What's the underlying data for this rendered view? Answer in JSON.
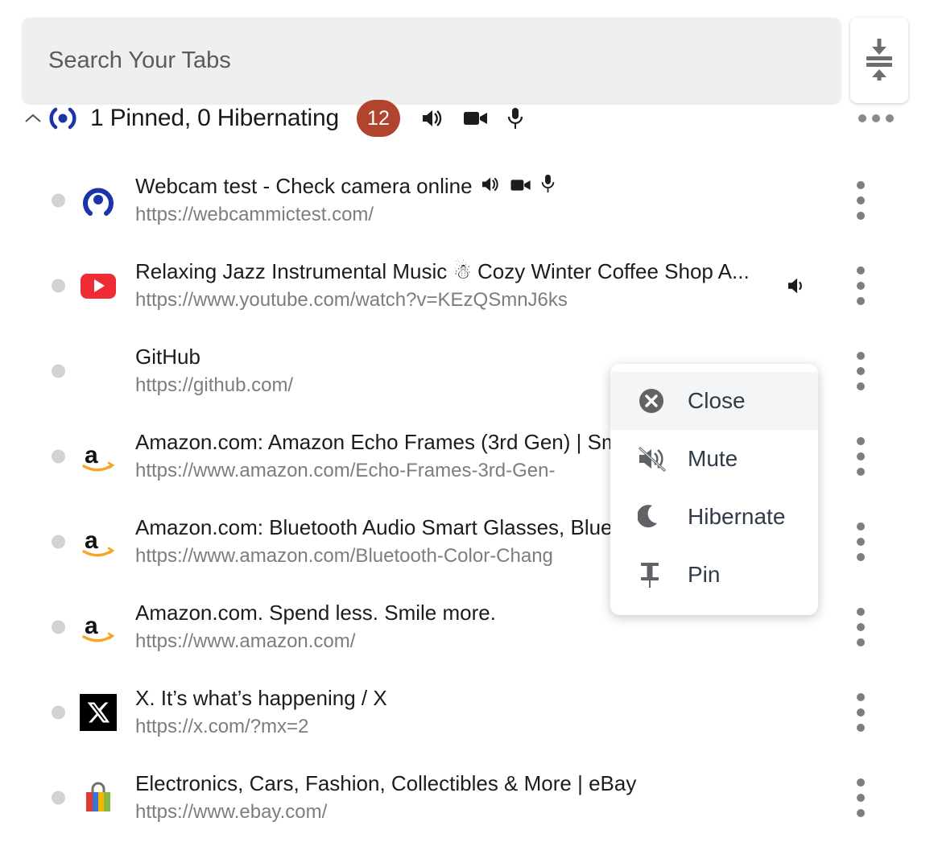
{
  "search": {
    "placeholder": "Search Your Tabs",
    "value": ""
  },
  "toolbar": {
    "merge_icon": "collapse-merge-icon",
    "overflow_icon": "more-horizontal-icon"
  },
  "group_header": {
    "collapse_icon": "chevron-up-icon",
    "favicon": "broadcast-icon",
    "title": "1 Pinned, 0 Hibernating",
    "count": "12",
    "badge_color": "#b1442f",
    "icons": [
      "speaker-icon",
      "video-camera-icon",
      "microphone-icon"
    ]
  },
  "tabs": [
    {
      "title": "Webcam test - Check camera online",
      "url": "https://webcammictest.com/",
      "favicon": "webcammictest-icon",
      "title_icons": [
        "speaker-icon",
        "video-camera-icon",
        "microphone-icon"
      ],
      "audio_icon": "",
      "menu_icon": "more-vertical-icon"
    },
    {
      "title": "Relaxing Jazz Instrumental Music ☃ Cozy Winter Coffee Shop A...",
      "url": "https://www.youtube.com/watch?v=KEzQSmnJ6ks",
      "favicon": "youtube-icon",
      "title_icons": [],
      "audio_icon": "speaker-icon",
      "menu_icon": "more-vertical-icon"
    },
    {
      "title": "GitHub",
      "url": "https://github.com/",
      "favicon": "blank-icon",
      "title_icons": [],
      "audio_icon": "",
      "menu_icon": "more-vertical-icon"
    },
    {
      "title": "Amazon.com: Amazon Echo Frames (3rd Gen) | Sm",
      "url": "https://www.amazon.com/Echo-Frames-3rd-Gen-",
      "favicon": "amazon-icon",
      "title_icons": [],
      "audio_icon": "",
      "menu_icon": "more-vertical-icon"
    },
    {
      "title": "Amazon.com: Bluetooth Audio Smart Glasses, Blue",
      "url": "https://www.amazon.com/Bluetooth-Color-Chang",
      "favicon": "amazon-icon",
      "title_icons": [],
      "audio_icon": "",
      "menu_icon": "more-vertical-icon"
    },
    {
      "title": "Amazon.com. Spend less. Smile more.",
      "url": "https://www.amazon.com/",
      "favicon": "amazon-icon",
      "title_icons": [],
      "audio_icon": "",
      "menu_icon": "more-vertical-icon"
    },
    {
      "title": "X. It’s what’s happening / X",
      "url": "https://x.com/?mx=2",
      "favicon": "x-icon",
      "title_icons": [],
      "audio_icon": "",
      "menu_icon": "more-vertical-icon"
    },
    {
      "title": "Electronics, Cars, Fashion, Collectibles & More | eBay",
      "url": "https://www.ebay.com/",
      "favicon": "ebay-icon",
      "title_icons": [],
      "audio_icon": "",
      "menu_icon": "more-vertical-icon"
    }
  ],
  "context_menu": {
    "items": [
      {
        "label": "Close",
        "icon": "close-circle-icon",
        "active": true
      },
      {
        "label": "Mute",
        "icon": "mute-icon",
        "active": false
      },
      {
        "label": "Hibernate",
        "icon": "moon-icon",
        "active": false
      },
      {
        "label": "Pin",
        "icon": "pin-icon",
        "active": false
      }
    ]
  }
}
